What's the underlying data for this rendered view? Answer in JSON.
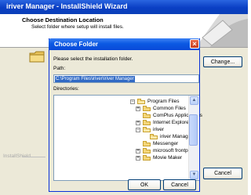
{
  "outer_window": {
    "title": "iriver Manager - InstallShield Wizard",
    "header_title": "Choose Destination Location",
    "header_subtitle": "Select folder where setup will install files.",
    "change_button": "Change...",
    "footer_label": "InstallShield",
    "cancel_button": "Cancel"
  },
  "dialog": {
    "title": "Choose Folder",
    "prompt": "Please select the installation folder.",
    "path_label": "Path:",
    "path_value": "C:\\Program Files\\iriver\\iriver Manager",
    "directories_label": "Directories:",
    "tree": [
      {
        "label": "Program Files",
        "expander": "−",
        "open": true
      },
      {
        "label": "Common Files",
        "expander": "+"
      },
      {
        "label": "ComPlus Applications",
        "expander": ""
      },
      {
        "label": "Internet Explorer",
        "expander": "+"
      },
      {
        "label": "iriver",
        "expander": "−",
        "open": true
      },
      {
        "label": "iriver Manager",
        "expander": "",
        "open": true
      },
      {
        "label": "Messenger",
        "expander": ""
      },
      {
        "label": "microsoft frontpage",
        "expander": "+"
      },
      {
        "label": "Movie Maker",
        "expander": "+"
      }
    ],
    "ok_button": "OK",
    "cancel_button": "Cancel"
  },
  "colors": {
    "title_bar": "#0a49d8",
    "selection": "#316ac5",
    "close_button": "#c93e1e"
  }
}
